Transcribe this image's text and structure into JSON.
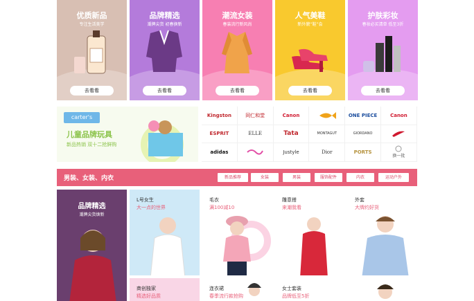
{
  "promos": [
    {
      "title": "优质新品",
      "sub": "专注生活美学",
      "button": "去看看",
      "color": "#d8bfb3"
    },
    {
      "title": "品牌精选",
      "sub": "潮牌尖货 初春换新",
      "button": "去看看",
      "color": "#b47bdb"
    },
    {
      "title": "潮流女装",
      "sub": "春装流行新风尚",
      "button": "去看看",
      "color": "#f77fb2"
    },
    {
      "title": "人气美鞋",
      "sub": "新外貌“鞋”会",
      "button": "去看看",
      "color": "#f9c92e"
    },
    {
      "title": "护肤彩妆",
      "sub": "春妆必买清单 低至3折",
      "button": "去看看",
      "color": "#e49cf0"
    }
  ],
  "carters": {
    "logo": "carter's",
    "title": "儿童品牌玩具",
    "sub": "新品热销 双十二抢鲜购"
  },
  "brands": [
    "Kingston",
    "同仁和堂",
    "Canon",
    "",
    "ONE PIECE",
    "Canon",
    "ESPRIT",
    "ELLE",
    "Tata",
    "MONTAGUT",
    "GIORDANO",
    "",
    "adidas",
    "",
    "Justyle",
    "Dior",
    "PORTS",
    "换一批"
  ],
  "section": {
    "title": "男装、女装、内衣",
    "tabs": [
      "新品推荐",
      "女装",
      "男装",
      "服饰配件",
      "内衣",
      "运动户外"
    ]
  },
  "featured": {
    "title": "品牌精选",
    "sub": "潮牌尖货焕新"
  },
  "cells": [
    {
      "title": "L号女生",
      "sub": "大一点的世界"
    },
    {
      "title": "毛衣",
      "sub": "满100减10"
    },
    {
      "title": "雕意搭",
      "sub": "来潮我看"
    },
    {
      "title": "外套",
      "sub": "大牌约好货"
    },
    {
      "title": "商创独家",
      "sub": "精选好品质"
    },
    {
      "title": "连衣裙",
      "sub": "春季流行款抢购"
    },
    {
      "title": "女士套装",
      "sub": "品牌低至5折"
    }
  ]
}
